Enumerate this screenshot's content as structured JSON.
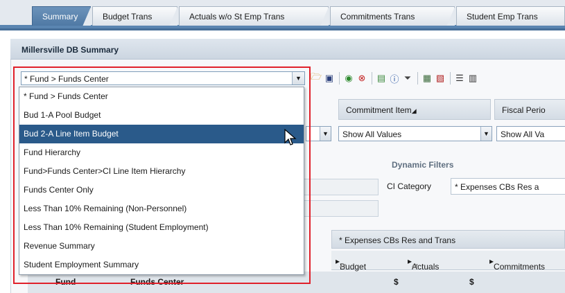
{
  "tabs": [
    {
      "label": "Summary",
      "active": true
    },
    {
      "label": "Budget Trans",
      "active": false
    },
    {
      "label": "Actuals w/o St Emp Trans",
      "active": false
    },
    {
      "label": "Commitments Trans",
      "active": false
    },
    {
      "label": "Student Emp Trans",
      "active": false
    }
  ],
  "panel": {
    "title": "Millersville DB Summary"
  },
  "view_select": {
    "value": "* Fund > Funds Center"
  },
  "toolbar": {
    "icons": [
      "open-folder-icon",
      "save-icon",
      "refresh-icon",
      "delete-icon",
      "export-icon",
      "info-icon",
      "filter-icon",
      "calculator-icon",
      "print-icon",
      "layout-icon",
      "more-icon"
    ]
  },
  "columns": {
    "commitment_item": "Commitment Item",
    "fiscal_period": "Fiscal Perio"
  },
  "value_selects": {
    "commitment_item": "Show All Values",
    "fiscal_period": "Show All Va"
  },
  "dynamic_filters": {
    "title": "Dynamic Filters",
    "ci_category_label": "CI Category",
    "ci_category_value": "* Expenses CBs Res a"
  },
  "grid": {
    "header": "* Expenses CBs Res and Trans",
    "measures": [
      "Budget",
      "Actuals",
      "Commitments"
    ],
    "currency_symbol": "$",
    "row_headers": [
      "Fund",
      "Funds Center"
    ]
  },
  "dropdown": {
    "items": [
      "* Fund > Funds Center",
      "Bud 1-A Pool Budget",
      "Bud 2-A Line Item Budget",
      "Fund Hierarchy",
      "Fund>Funds Center>CI Line Item Hierarchy",
      "Funds Center Only",
      "Less Than 10% Remaining (Non-Personnel)",
      "Less Than 10% Remaining (Student Employment)",
      "Revenue Summary",
      "Student Employment Summary"
    ],
    "selected_index": 2
  },
  "colors": {
    "tab_active": "#4f79a4",
    "selection": "#2a5a8a",
    "highlight_border": "#e0202a"
  }
}
